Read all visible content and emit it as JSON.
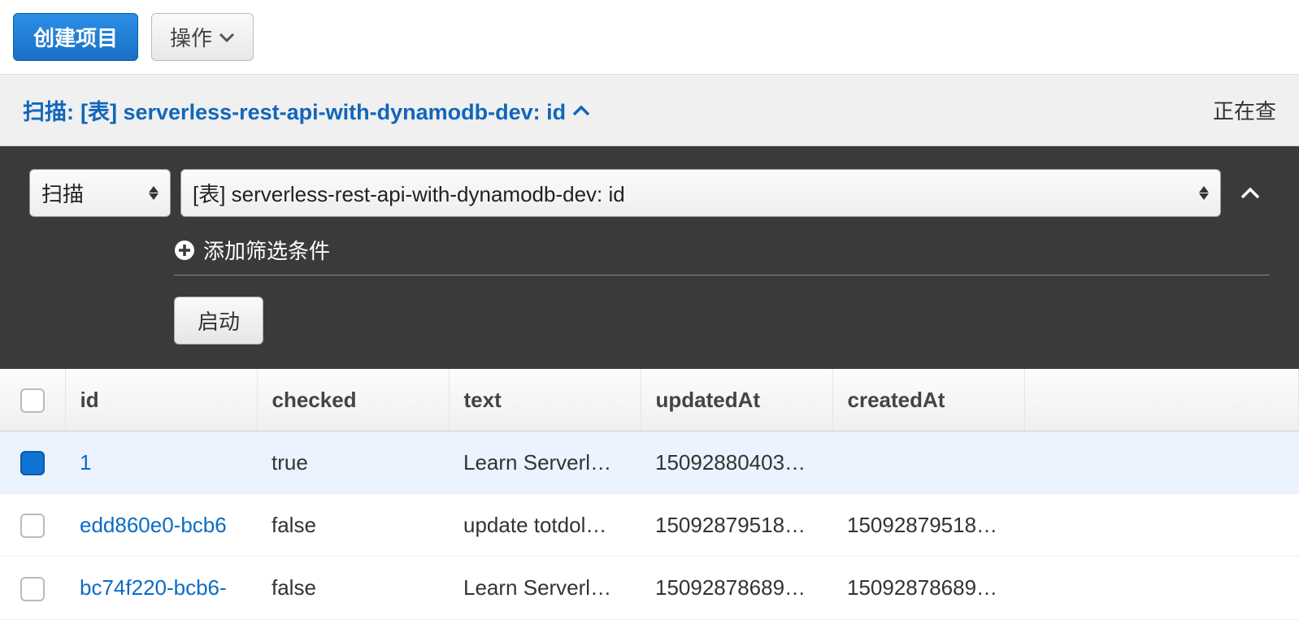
{
  "toolbar": {
    "create_label": "创建项目",
    "actions_label": "操作"
  },
  "scan_header": {
    "title_prefix": "扫描: ",
    "title_detail": "[表] serverless-rest-api-with-dynamodb-dev: id",
    "status": "正在查"
  },
  "dark_panel": {
    "scan_option": "扫描",
    "table_option": "[表] serverless-rest-api-with-dynamodb-dev: id",
    "add_filter": "添加筛选条件",
    "start": "启动"
  },
  "table": {
    "headers": {
      "id": "id",
      "checked": "checked",
      "text": "text",
      "updatedAt": "updatedAt",
      "createdAt": "createdAt"
    },
    "rows": [
      {
        "selected": true,
        "id": "1",
        "checked": "true",
        "text": "Learn Serverl…",
        "updatedAt": "15092880403…",
        "createdAt": ""
      },
      {
        "selected": false,
        "id": "edd860e0-bcb6",
        "checked": "false",
        "text": "update totdol…",
        "updatedAt": "15092879518…",
        "createdAt": "15092879518…"
      },
      {
        "selected": false,
        "id": "bc74f220-bcb6-",
        "checked": "false",
        "text": "Learn Serverl…",
        "updatedAt": "15092878689…",
        "createdAt": "15092878689…"
      }
    ]
  }
}
